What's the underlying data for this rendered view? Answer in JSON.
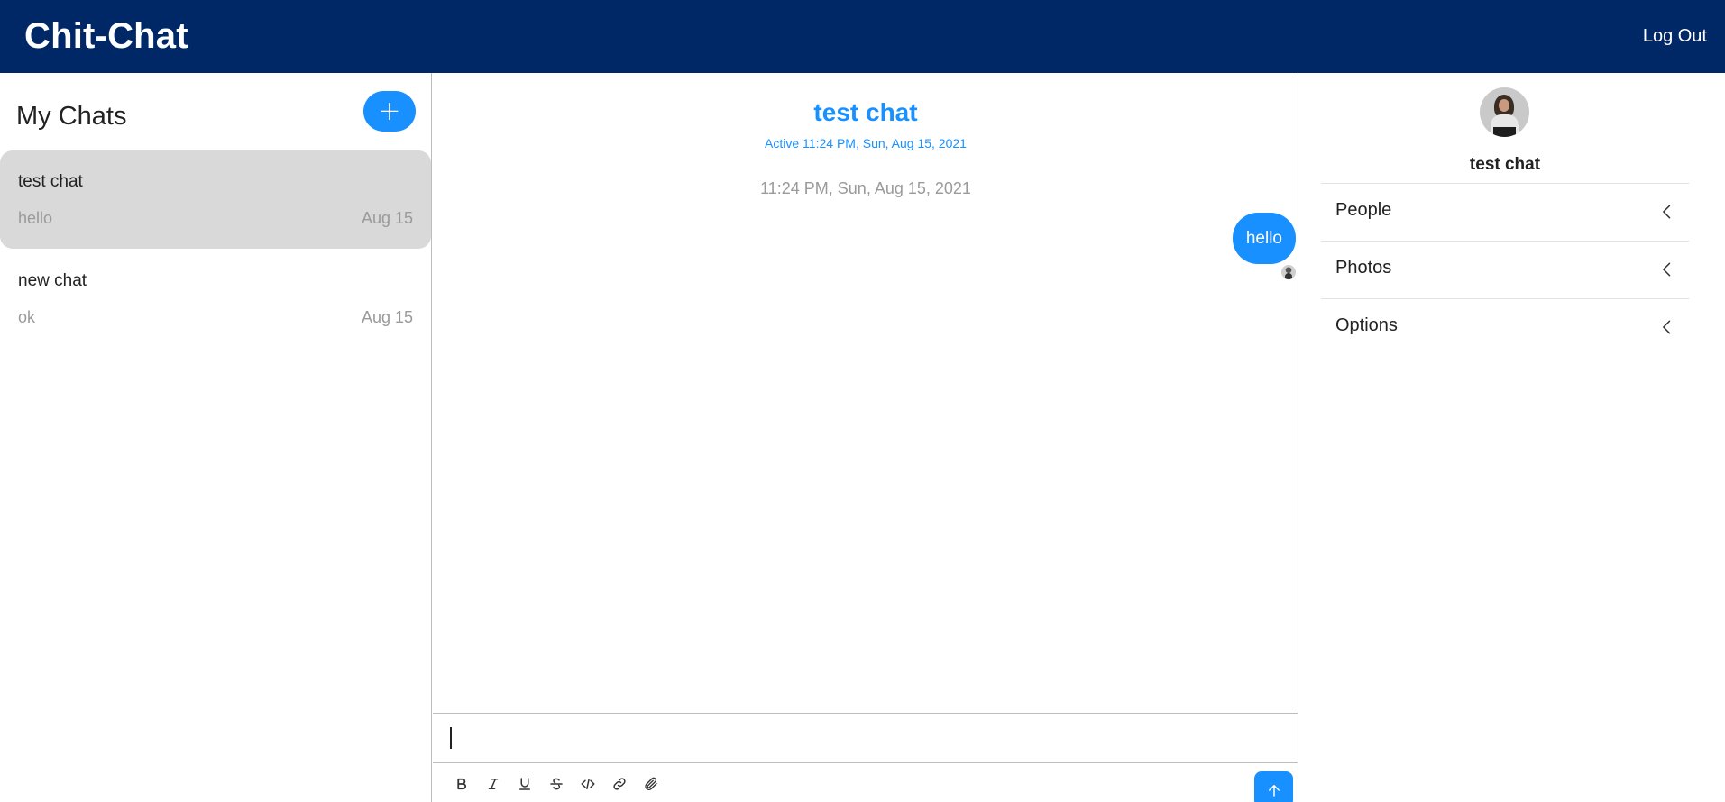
{
  "header": {
    "app_title": "Chit-Chat",
    "logout_label": "Log Out",
    "background_color": "#002766"
  },
  "sidebar": {
    "title": "My Chats",
    "new_chat_label": "+",
    "chats": [
      {
        "title": "test chat",
        "preview": "hello",
        "date": "Aug 15",
        "active": true
      },
      {
        "title": "new chat",
        "preview": "ok",
        "date": "Aug 15",
        "active": false
      }
    ]
  },
  "conversation": {
    "title": "test chat",
    "active_status": "Active 11:24 PM, Sun, Aug 15, 2021",
    "timestamp": "11:24 PM, Sun, Aug 15, 2021",
    "messages": [
      {
        "text": "hello",
        "own": true
      }
    ],
    "accent_color": "#1890ff"
  },
  "composer": {
    "value": "",
    "placeholder": "",
    "tools": [
      "bold-icon",
      "italic-icon",
      "underline-icon",
      "strikethrough-icon",
      "code-icon",
      "link-icon",
      "attachment-icon"
    ],
    "send_icon": "arrow-up-icon"
  },
  "details": {
    "name": "test chat",
    "sections": [
      "People",
      "Photos",
      "Options"
    ]
  }
}
